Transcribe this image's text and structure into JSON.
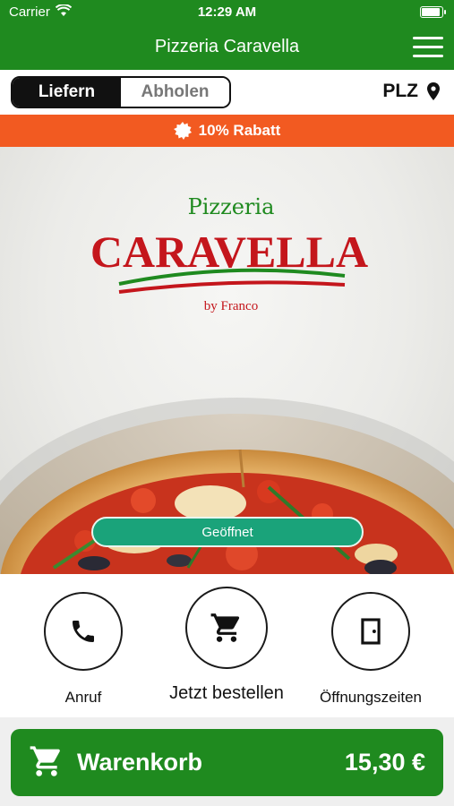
{
  "status_bar": {
    "carrier": "Carrier",
    "time": "12:29 AM",
    "battery_level": 0.95
  },
  "nav": {
    "title": "Pizzeria Caravella",
    "menu_icon": "hamburger-menu-icon"
  },
  "delivery_toggle": {
    "options": [
      "Liefern",
      "Abholen"
    ],
    "selected": "Liefern"
  },
  "location": {
    "label": "PLZ",
    "icon": "location-pin-icon"
  },
  "discount": {
    "text": "10% Rabatt",
    "icon": "badge-icon",
    "color": "#f25a21"
  },
  "hero": {
    "logo": {
      "line1": "Pizzeria",
      "line2": "CARAVELLA",
      "line3": "by Franco"
    },
    "status": "Geöffnet"
  },
  "actions": [
    {
      "label": "Anruf",
      "icon": "phone-icon"
    },
    {
      "label": "Jetzt bestellen",
      "icon": "cart-icon"
    },
    {
      "label": "Öffnungszeiten",
      "icon": "door-icon"
    }
  ],
  "cart": {
    "label": "Warenkorb",
    "total": "15,30 €",
    "icon": "cart-icon"
  },
  "colors": {
    "primary_green": "#1f8a1f",
    "accent_orange": "#f25a21",
    "status_green": "#1aa37a",
    "logo_red": "#c4161c"
  }
}
